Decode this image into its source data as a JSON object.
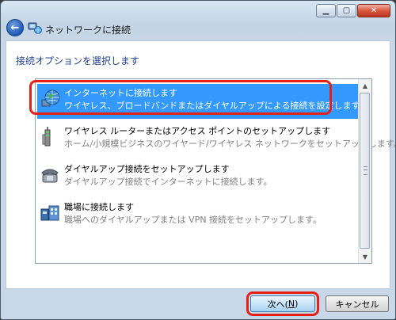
{
  "window": {
    "title": "ネットワークに接続",
    "controls": {
      "minimize": "▁",
      "maximize": "▢",
      "close": "✕"
    }
  },
  "content": {
    "instruction": "接続オプションを選択します"
  },
  "options": [
    {
      "title": "インターネットに接続します",
      "description": "ワイヤレス、ブロードバンドまたはダイヤルアップによる接続を設定します。",
      "icon": "globe-network-icon",
      "selected": true
    },
    {
      "title": "ワイヤレス ルーターまたはアクセス ポイントのセットアップします",
      "description": "ホーム/小規模ビジネスのワイヤード/ワイヤレス ネットワークをセットアップします。",
      "icon": "router-icon",
      "selected": false
    },
    {
      "title": "ダイヤルアップ接続をセットアップします",
      "description": "ダイヤルアップ接続でインターネットに接続します。",
      "icon": "phone-icon",
      "selected": false
    },
    {
      "title": "職場に接続します",
      "description": "職場へのダイヤルアップまたは VPN 接続をセットアップします。",
      "icon": "workplace-icon",
      "selected": false
    }
  ],
  "buttons": {
    "next_label": "次へ(",
    "next_key": "N",
    "next_suffix": ")",
    "cancel_label": "キャンセル"
  },
  "colors": {
    "selection": "#3399ff",
    "highlight_outline": "#e4201a",
    "instruction_text": "#1f3f8f"
  }
}
